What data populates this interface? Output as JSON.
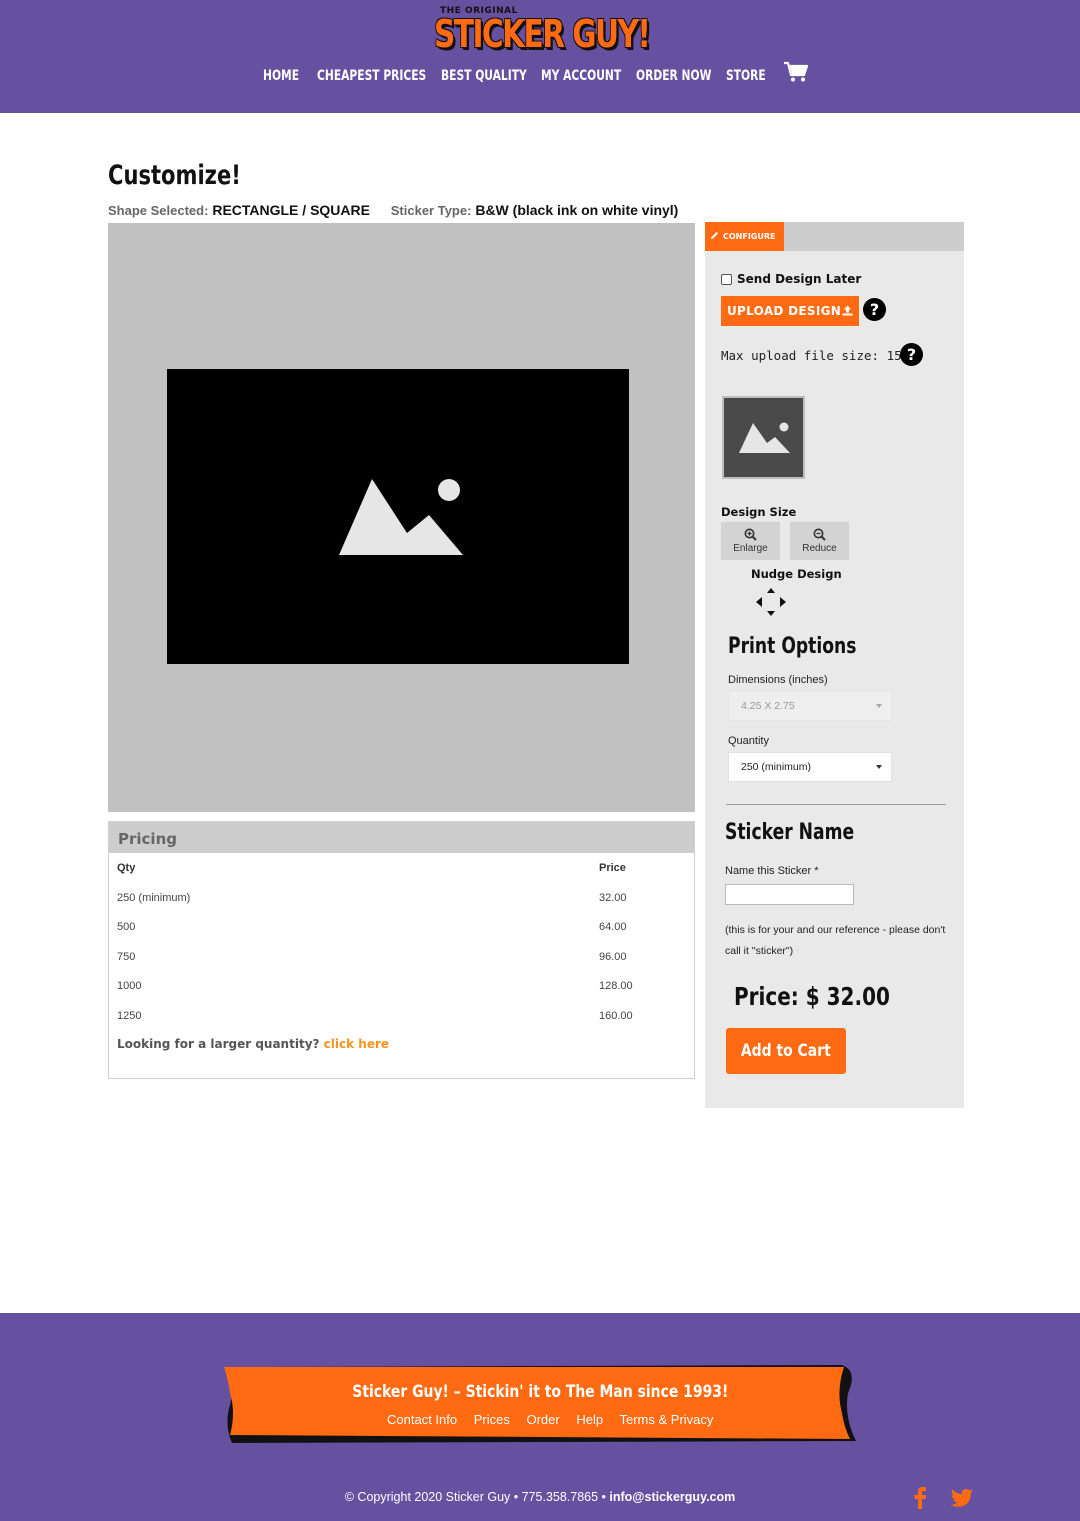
{
  "brand": {
    "tagline_small": "THE ORIGINAL",
    "name": "STICKER GUY!"
  },
  "nav": {
    "items": [
      "HOME",
      "CHEAPEST PRICES",
      "BEST QUALITY",
      "MY ACCOUNT",
      "ORDER NOW",
      "STORE"
    ],
    "cart_icon": "cart-icon"
  },
  "main": {
    "title": "Customize!",
    "shape_label": "Shape Selected:",
    "shape_value": "RECTANGLE / SQUARE",
    "type_label": "Sticker Type:",
    "type_value": "B&W (black ink on white vinyl)"
  },
  "pricing": {
    "heading": "Pricing",
    "columns": [
      "Qty",
      "Price"
    ],
    "rows": [
      {
        "qty": "250 (minimum)",
        "price": "32.00"
      },
      {
        "qty": "500",
        "price": "64.00"
      },
      {
        "qty": "750",
        "price": "96.00"
      },
      {
        "qty": "1000",
        "price": "128.00"
      },
      {
        "qty": "1250",
        "price": "160.00"
      }
    ],
    "larger_text": "Looking for a larger quantity?",
    "larger_link": "click here"
  },
  "config": {
    "tab": "CONFIGURE",
    "send_later": "Send Design Later",
    "upload": "UPLOAD DESIGN",
    "max_upload": "Max upload file size: 15MB",
    "design_size": "Design Size",
    "enlarge": "Enlarge",
    "reduce": "Reduce",
    "nudge": "Nudge Design",
    "print_options": "Print Options",
    "dimensions_label": "Dimensions (inches)",
    "dimensions_value": "4.25 X 2.75",
    "quantity_label": "Quantity",
    "quantity_value": "250 (minimum)",
    "sticker_name_title": "Sticker Name",
    "name_label": "Name this Sticker *",
    "name_value": "",
    "note": "(this is for your and our reference - please don't call it \"sticker\")",
    "price": "Price: $ 32.00",
    "add_to_cart": "Add to Cart"
  },
  "footer": {
    "slogan": "Sticker Guy! – Stickin' it to The Man since 1993!",
    "links": [
      "Contact Info",
      "Prices",
      "Order",
      "Help",
      "Terms & Privacy"
    ],
    "copyright": "© Copyright 2020 Sticker Guy • 775.358.7865 •",
    "email": "info@stickerguy.com"
  },
  "colors": {
    "header": "#6651a1",
    "accent": "#ff6a13",
    "link_orange": "#f7941d"
  }
}
